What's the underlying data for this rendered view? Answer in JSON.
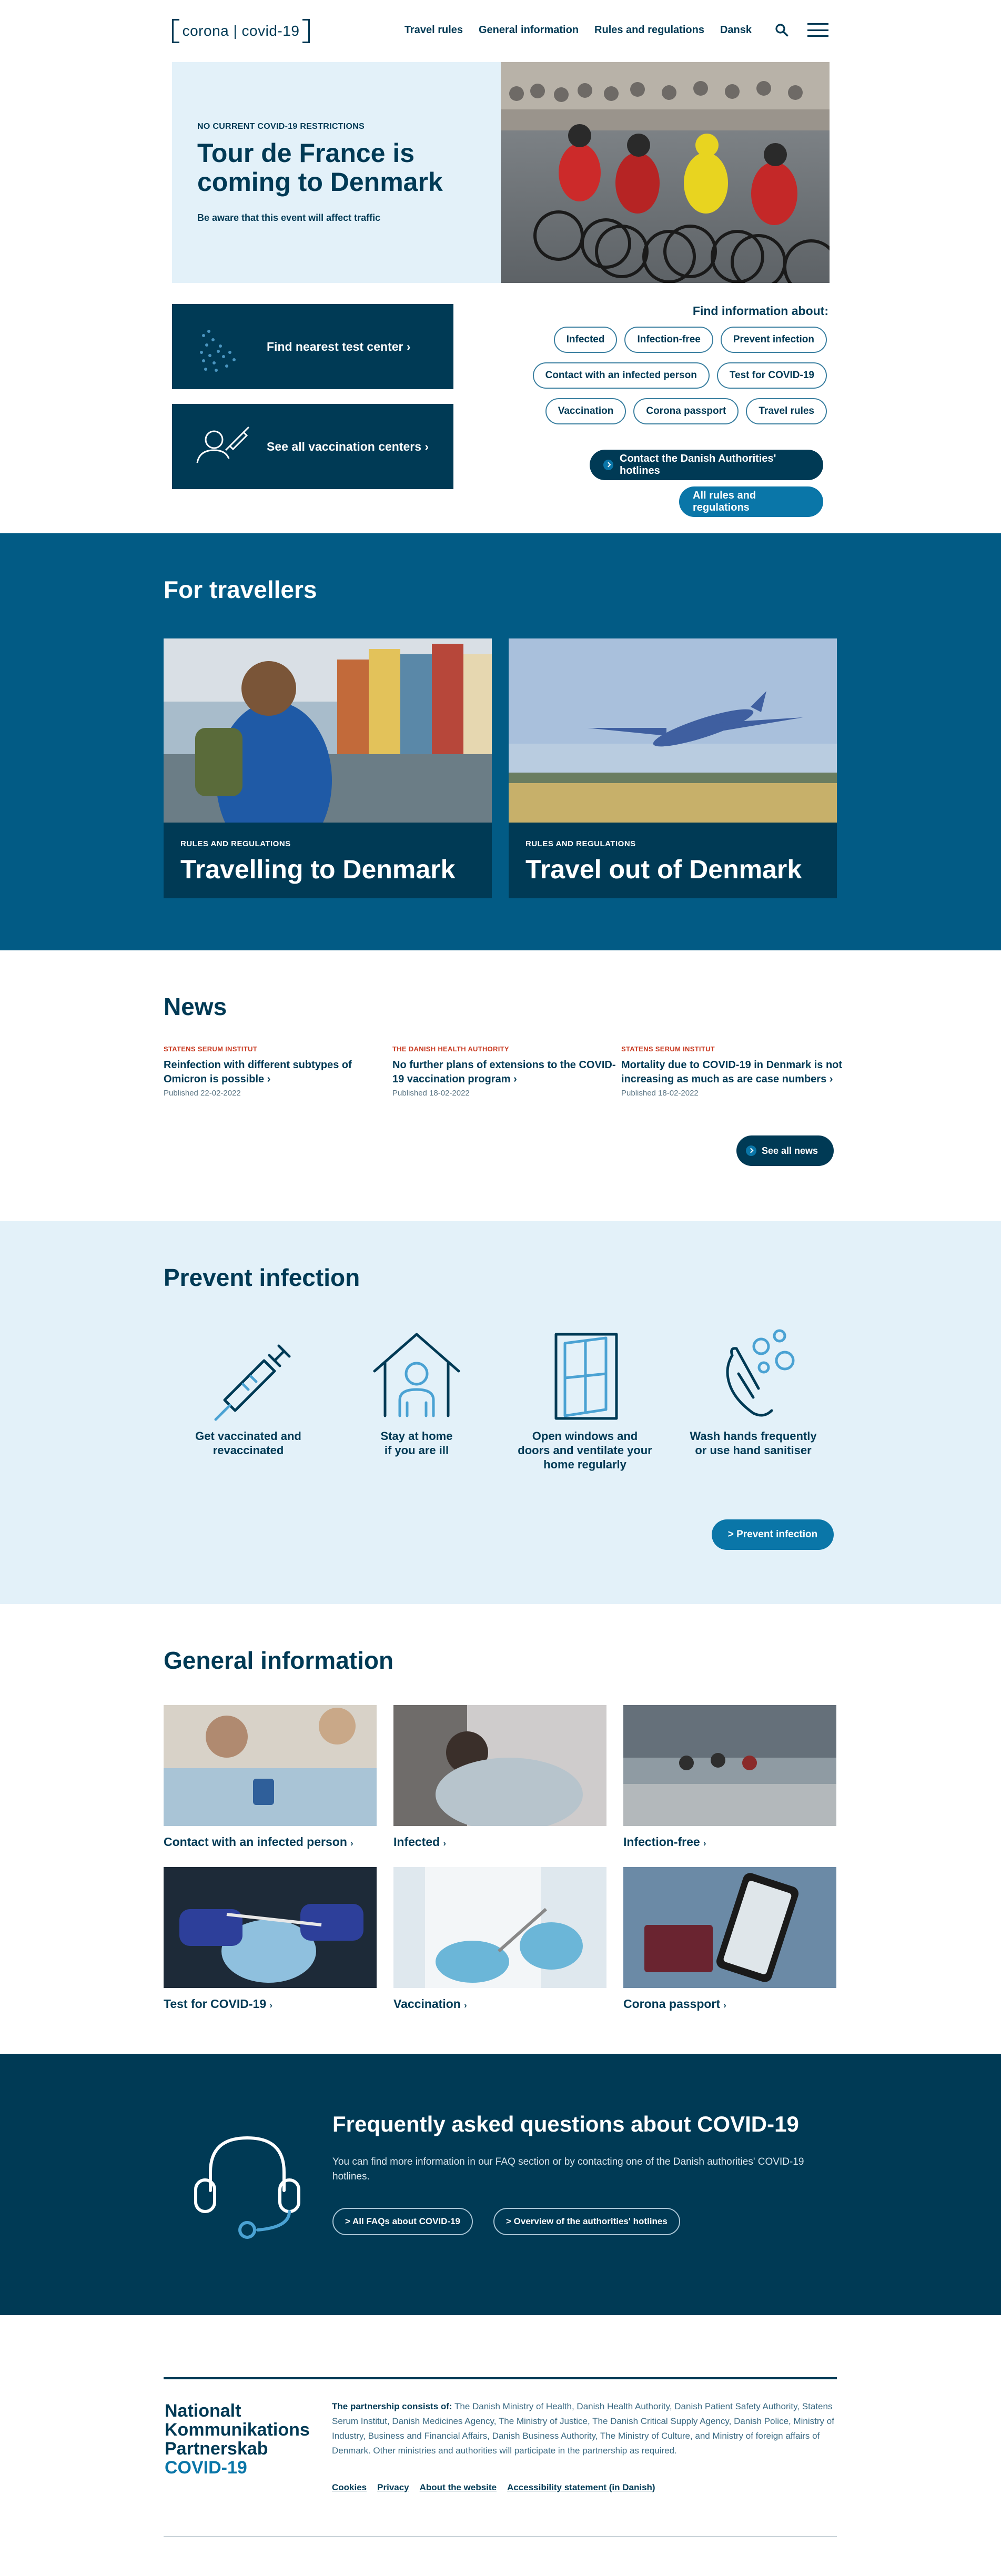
{
  "header": {
    "logo_text": "corona | covid-19",
    "nav": [
      "Travel rules",
      "General information",
      "Rules and regulations",
      "Dansk"
    ]
  },
  "hero": {
    "kicker": "NO CURRENT COVID-19 RESTRICTIONS",
    "title_line1": "Tour de France is",
    "title_line2": "coming to Denmark",
    "subtitle": "Be aware that this event will affect traffic"
  },
  "quick_links": {
    "test_center": "Find nearest test center ›",
    "vaccination": "See all vaccination centers ›"
  },
  "find": {
    "heading": "Find information about:",
    "chips_row1": [
      "Infected",
      "Infection-free",
      "Prevent infection"
    ],
    "chips_row2": [
      "Contact with an infected person",
      "Test for COVID-19"
    ],
    "chips_row3": [
      "Vaccination",
      "Corona passport",
      "Travel rules"
    ],
    "hotlines_button": "Contact the Danish Authorities' hotlines",
    "rules_button": "All rules and regulations"
  },
  "travellers": {
    "title": "For travellers",
    "cards": [
      {
        "kicker": "RULES AND REGULATIONS",
        "title": "Travelling to Denmark"
      },
      {
        "kicker": "RULES AND REGULATIONS",
        "title": "Travel out of Denmark"
      }
    ]
  },
  "news": {
    "title": "News",
    "items": [
      {
        "source": "STATENS SERUM INSTITUT",
        "title": "Reinfection with different subtypes of Omicron is possible ›",
        "date": "Published 22-02-2022"
      },
      {
        "source": "THE DANISH HEALTH AUTHORITY",
        "title": "No further plans of extensions to the COVID-19 vaccination program ›",
        "date": "Published 18-02-2022"
      },
      {
        "source": "STATENS SERUM INSTITUT",
        "title": "Mortality due to COVID-19 in Denmark is not increasing as much as are case numbers ›",
        "date": "Published 18-02-2022"
      }
    ],
    "see_all": "See all news"
  },
  "prevent": {
    "title": "Prevent infection",
    "items": [
      {
        "line1": "Get vaccinated and",
        "line2": "revaccinated",
        "line3": ""
      },
      {
        "line1": "Stay at home",
        "line2": "if you are ill",
        "line3": ""
      },
      {
        "line1": "Open windows and",
        "line2": "doors and ventilate your",
        "line3": "home regularly"
      },
      {
        "line1": "Wash hands frequently",
        "line2": "or use hand sanitiser",
        "line3": ""
      }
    ],
    "button": "> Prevent infection"
  },
  "general": {
    "title": "General information",
    "cards": [
      {
        "label": "Contact with an infected person",
        "arrow": "›"
      },
      {
        "label": "Infected",
        "arrow": "›"
      },
      {
        "label": "Infection-free",
        "arrow": "›"
      },
      {
        "label": "Test for COVID-19",
        "arrow": "›"
      },
      {
        "label": "Vaccination",
        "arrow": "›"
      },
      {
        "label": "Corona passport",
        "arrow": "›"
      }
    ]
  },
  "faq": {
    "title": "Frequently asked questions about COVID-19",
    "text": "You can find more information in our FAQ section or by contacting one of the Danish authorities' COVID-19 hotlines.",
    "btn1": ">  All FAQs about COVID-19",
    "btn2": ">  Overview of the authorities' hotlines"
  },
  "footer": {
    "logo_line1": "Nationalt",
    "logo_line2": "Kommunikations",
    "logo_line3": "Partnerskab",
    "logo_line4": "COVID-19",
    "partners_label": "The partnership consists of:",
    "partners_text": " The Danish Ministry of Health, Danish Health Authority, Danish Patient Safety Authority, Statens Serum Institut, Danish Medicines Agency, The Ministry of Justice, The Danish Critical Supply Agency, Danish Police, Ministry of Industry, Business and Financial Affairs, Danish Business Authority, The Ministry of Culture, and Ministry of foreign affairs of Denmark. Other ministries and authorities will participate in the partnership as required.",
    "links": [
      "Cookies",
      "Privacy",
      "About the website",
      "Accessibility statement (in Danish)"
    ]
  }
}
